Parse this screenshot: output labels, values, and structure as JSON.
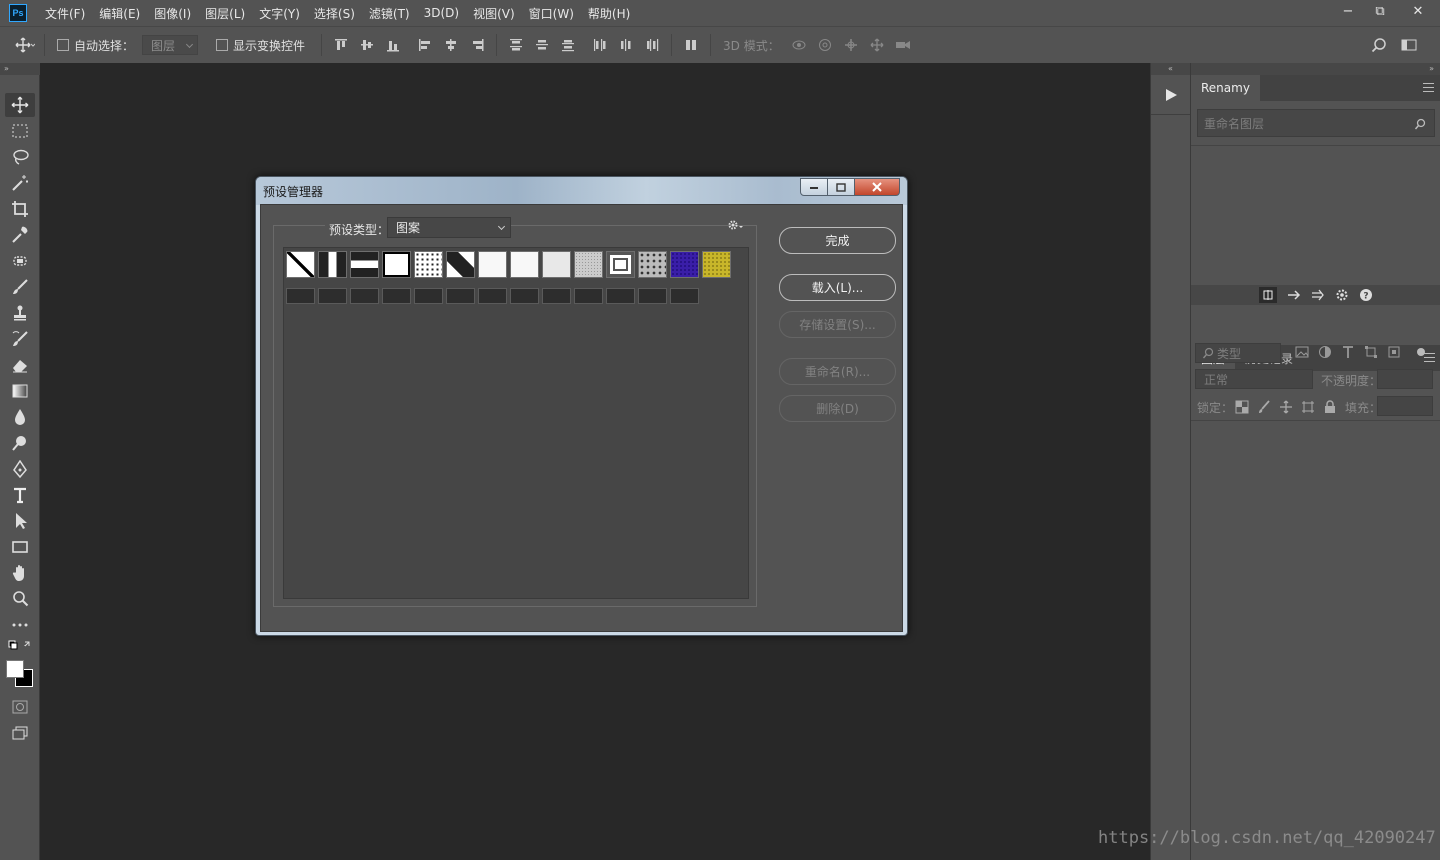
{
  "app": {
    "logo_text": "Ps"
  },
  "menu": [
    "文件(F)",
    "编辑(E)",
    "图像(I)",
    "图层(L)",
    "文字(Y)",
    "选择(S)",
    "滤镜(T)",
    "3D(D)",
    "视图(V)",
    "窗口(W)",
    "帮助(H)"
  ],
  "window_controls": {
    "minimize": "−",
    "restore": "⧉",
    "close": "✕"
  },
  "options": {
    "auto_select_label": "自动选择：",
    "auto_select_value": "图层",
    "show_transform_label": "显示变换控件",
    "mode_3d_label": "3D 模式："
  },
  "panels": {
    "collapse_left": "»",
    "collapse_right": "«",
    "expand_right": "»",
    "renamy_tab": "Renamy",
    "renamy_search_placeholder": "重命名图层",
    "layers_tab": "图层",
    "history_tab": "历史记录",
    "filter_kind": "类型",
    "blend_mode": "正常",
    "opacity_label": "不透明度：",
    "lock_label": "锁定：",
    "fill_label": "填充："
  },
  "dialog": {
    "title": "预设管理器",
    "preset_type_label": "预设类型：",
    "preset_type_value": "图案",
    "buttons": {
      "done": "完成",
      "load": "载入(L)...",
      "save": "存储设置(S)...",
      "rename": "重命名(R)...",
      "delete": "删除(D)"
    },
    "patterns_row1": [
      "diagonal-line",
      "vertical-bar",
      "horizontal-bar",
      "white-square",
      "dot-grid",
      "diagonal-stripe",
      "white",
      "white",
      "light-gray",
      "noise-gray",
      "concentric-square",
      "cloud-texture",
      "blue-velvet",
      "yellow-texture"
    ],
    "patterns_row2_count": 13
  },
  "watermark": "https://blog.csdn.net/qq_42090247"
}
